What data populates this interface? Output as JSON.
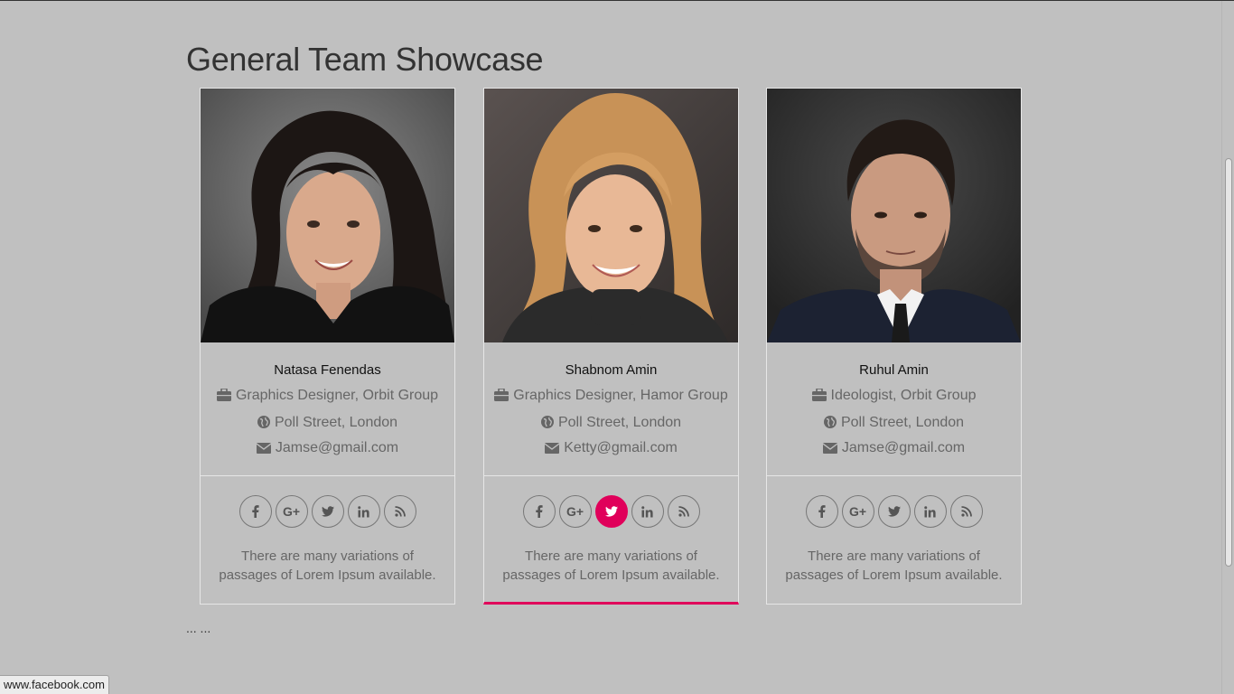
{
  "page": {
    "title": "General Team Showcase",
    "footer_text": "... ..."
  },
  "status_bar": {
    "url": "www.facebook.com"
  },
  "members": [
    {
      "name": "Natasa Fenendas",
      "role": "Graphics Designer, Orbit Group",
      "location": "Poll Street, London",
      "email": "Jamse@gmail.com",
      "description": "There are many variations of passages of Lorem Ipsum available.",
      "active_social": null
    },
    {
      "name": "Shabnom Amin",
      "role": "Graphics Designer, Hamor Group",
      "location": "Poll Street, London",
      "email": "Ketty@gmail.com",
      "description": "There are many variations of passages of Lorem Ipsum available.",
      "active_social": "twitter"
    },
    {
      "name": "Ruhul Amin",
      "role": "Ideologist, Orbit Group",
      "location": "Poll Street, London",
      "email": "Jamse@gmail.com",
      "description": "There are many variations of passages of Lorem Ipsum available.",
      "active_social": null
    }
  ],
  "social_icons": [
    "facebook-icon",
    "google-plus-icon",
    "twitter-icon",
    "linkedin-icon",
    "rss-icon"
  ],
  "colors": {
    "accent": "#e0005a",
    "background": "#c0c0c0"
  }
}
